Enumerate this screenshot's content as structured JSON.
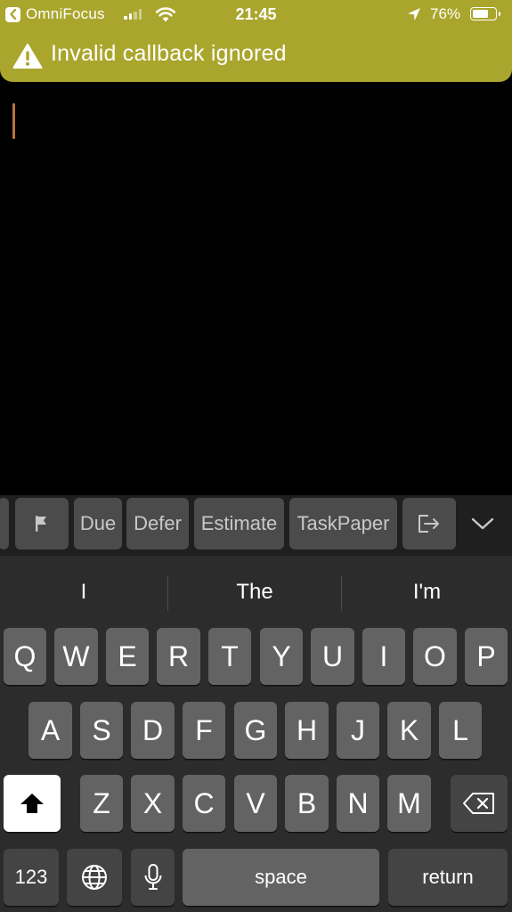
{
  "status_bar": {
    "back_app": "OmniFocus",
    "time": "21:45",
    "battery_percent": "76%",
    "battery_level": 0.76,
    "signal_bars_on": 2,
    "signal_bars_total": 4
  },
  "banner": {
    "message": "Invalid callback ignored",
    "icon": "warning-icon",
    "color": "#aaa62d"
  },
  "editor": {
    "text": "",
    "caret_color": "#b9733a"
  },
  "toolbar": {
    "flag_icon": "flag-icon",
    "due": "Due",
    "defer": "Defer",
    "estimate": "Estimate",
    "taskpaper": "TaskPaper",
    "share_icon": "share-icon",
    "dismiss_icon": "chevron-down-icon"
  },
  "keyboard": {
    "suggestions": [
      "I",
      "The",
      "I'm"
    ],
    "row1": [
      "Q",
      "W",
      "E",
      "R",
      "T",
      "Y",
      "U",
      "I",
      "O",
      "P"
    ],
    "row2": [
      "A",
      "S",
      "D",
      "F",
      "G",
      "H",
      "J",
      "K",
      "L"
    ],
    "row3": [
      "Z",
      "X",
      "C",
      "V",
      "B",
      "N",
      "M"
    ],
    "numbers_key": "123",
    "space_key": "space",
    "return_key": "return"
  }
}
